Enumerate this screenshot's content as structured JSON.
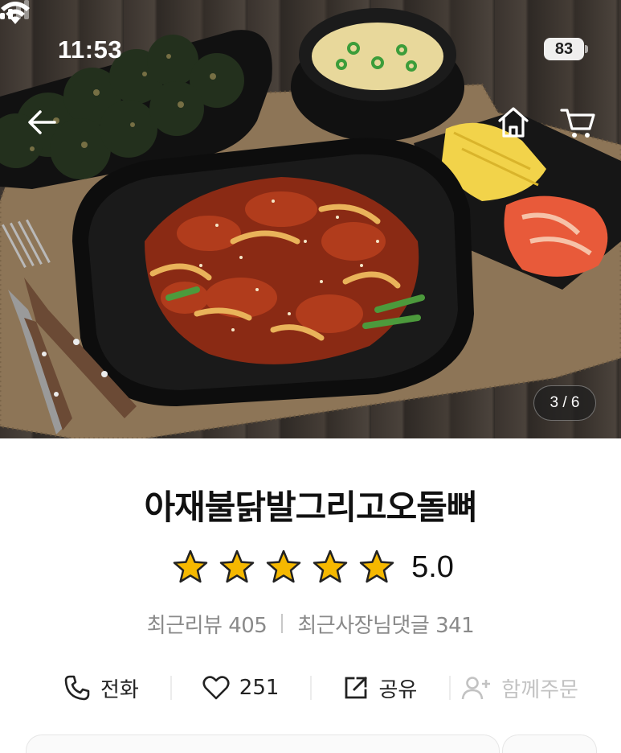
{
  "status_bar": {
    "time": "11:53",
    "battery": "83"
  },
  "hero": {
    "image_alt_icon": "food-photo",
    "page_indicator": "3 / 6"
  },
  "product": {
    "title": "아재불닭발그리고오돌뼈",
    "rating": 5.0,
    "rating_text": "5.0",
    "recent_reviews": "최근리뷰 405",
    "owner_replies": "최근사장님댓글 341"
  },
  "actions": {
    "call_label": "전화",
    "like_count": "251",
    "share_label": "공유",
    "group_order_label": "함께주문"
  },
  "colors": {
    "star": "#F5B800",
    "text_primary": "#111111",
    "text_secondary": "#8A8A8A",
    "disabled": "#C2C2C2"
  }
}
